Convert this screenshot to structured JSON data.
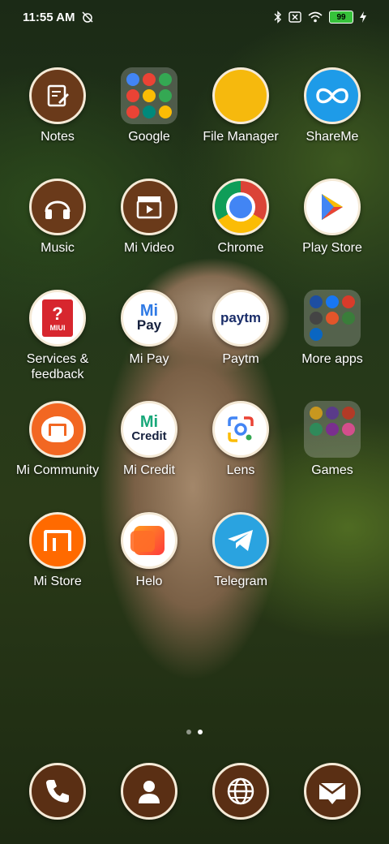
{
  "status": {
    "time": "11:55 AM",
    "battery": "99"
  },
  "apps": [
    {
      "label": "Notes"
    },
    {
      "label": "Google"
    },
    {
      "label": "File Manager"
    },
    {
      "label": "ShareMe"
    },
    {
      "label": "Music"
    },
    {
      "label": "Mi Video"
    },
    {
      "label": "Chrome"
    },
    {
      "label": "Play Store"
    },
    {
      "label": "Services & feedback"
    },
    {
      "label": "Mi Pay"
    },
    {
      "label": "Paytm"
    },
    {
      "label": "More apps"
    },
    {
      "label": "Mi Community"
    },
    {
      "label": "Mi Credit"
    },
    {
      "label": "Lens"
    },
    {
      "label": "Games"
    },
    {
      "label": "Mi Store"
    },
    {
      "label": "Helo"
    },
    {
      "label": "Telegram"
    }
  ],
  "icon_text": {
    "miui": "MIUI",
    "mi_pay": "Pay",
    "paytm": "paytm",
    "mi_credit": "Credit",
    "mi": "Mi"
  },
  "pages": {
    "count": 2,
    "active": 2
  },
  "dock": [
    {
      "icon": "phone-icon"
    },
    {
      "icon": "contacts-icon"
    },
    {
      "icon": "browser-icon"
    },
    {
      "icon": "messaging-icon"
    }
  ],
  "colors": {
    "icon_rim": "#f5ead7",
    "icon_brown": "#5a2f14"
  }
}
